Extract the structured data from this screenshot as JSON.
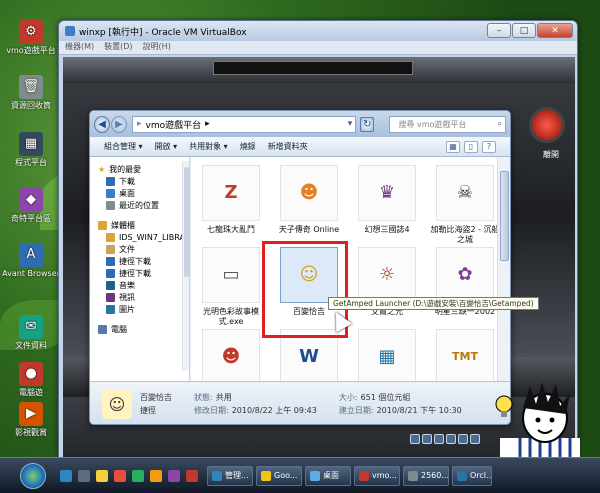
{
  "desktop": {
    "icons": [
      {
        "label": "vmo遊戲平台",
        "color": "#c0392b",
        "glyph": "⚙"
      },
      {
        "label": "資源回收筒",
        "color": "#7f8c8d",
        "glyph": "🗑"
      },
      {
        "label": "程式平台",
        "color": "#34495e",
        "glyph": "▦"
      },
      {
        "label": "奇特平台區",
        "color": "#8e44ad",
        "glyph": "◆"
      },
      {
        "label": "Avant Browser",
        "color": "#2e6db4",
        "glyph": "A"
      },
      {
        "label": "文件資料",
        "color": "#16a085",
        "glyph": "✉"
      },
      {
        "label": "電腦遊",
        "color": "#c0392b",
        "glyph": "●"
      },
      {
        "label": "影視觀賞",
        "color": "#d35400",
        "glyph": "▶"
      }
    ]
  },
  "vbox": {
    "title": "winxp [執行中] - Oracle VM VirtualBox",
    "menu": [
      "機器(M)",
      "裝置(D)",
      "說明(H)"
    ],
    "guest_button_label": "離開"
  },
  "explorer": {
    "breadcrumb": [
      "vmo遊戲平台"
    ],
    "search_placeholder": "搜尋 vmo遊戲平台",
    "toolbar": [
      "組合管理 ▾",
      "開啟 ▾",
      "共用對象 ▾",
      "燒錄",
      "新增資料夾"
    ],
    "nav": {
      "favorites_title": "我的最愛",
      "favorites": [
        "下載",
        "桌面",
        "最近的位置"
      ],
      "libraries_title": "媒體櫃",
      "libraries": [
        "IDS_WIN7_LIBRA",
        "文件",
        "捷徑下載",
        "捷徑下載",
        "音樂",
        "視訊",
        "圖片"
      ],
      "computer_title": "電腦"
    },
    "items": [
      {
        "label": "七龍珠大亂鬥",
        "art": "Z",
        "color": "#c0392b"
      },
      {
        "label": "天子傳奇 Online",
        "art": "☻",
        "color": "#e67e22"
      },
      {
        "label": "幻想三國誌4",
        "art": "♛",
        "color": "#6c3483"
      },
      {
        "label": "加勒比海盜2 - 沉船之城",
        "art": "☠",
        "color": "#333333"
      },
      {
        "label": "光明色彩故事模式.exe",
        "art": "▭",
        "color": "#555555"
      },
      {
        "label": "百變恰吉",
        "art": "☺",
        "color": "#d4a017"
      },
      {
        "label": "艾爾之光",
        "art": "☼",
        "color": "#a93226"
      },
      {
        "label": "明星三缺一2002",
        "art": "✿",
        "color": "#7d3c98"
      },
      {
        "label": "",
        "art": "☻",
        "color": "#c0392b"
      },
      {
        "label": "",
        "art": "W",
        "color": "#1f4e8c"
      },
      {
        "label": "",
        "art": "▦",
        "color": "#2874a6"
      },
      {
        "label": "",
        "art": "TMT",
        "color": "#b9770e"
      }
    ],
    "tooltip": "GetAmped Launcher (D:\\遊戲安裝\\百變恰吉\\Getamped)",
    "details": {
      "name": "百變恰吉",
      "type": "捷徑",
      "status_label": "狀態:",
      "status_value": "共用",
      "modified_label": "修改日期:",
      "modified_value": "2010/8/22 上午 09:43",
      "size_label": "大小:",
      "size_value": "651 個位元組",
      "created_label": "建立日期:",
      "created_value": "2010/8/21 下午 10:30"
    }
  },
  "taskbar": {
    "tasks": [
      {
        "label": "管理...",
        "color": "#2e86c1"
      },
      {
        "label": "Goo...",
        "color": "#f1c40f"
      },
      {
        "label": "桌面",
        "color": "#5dade2"
      },
      {
        "label": "vmo...",
        "color": "#c0392b"
      },
      {
        "label": "2560...",
        "color": "#7f8c8d"
      },
      {
        "label": "Orcl...",
        "color": "#2874a6"
      }
    ]
  }
}
